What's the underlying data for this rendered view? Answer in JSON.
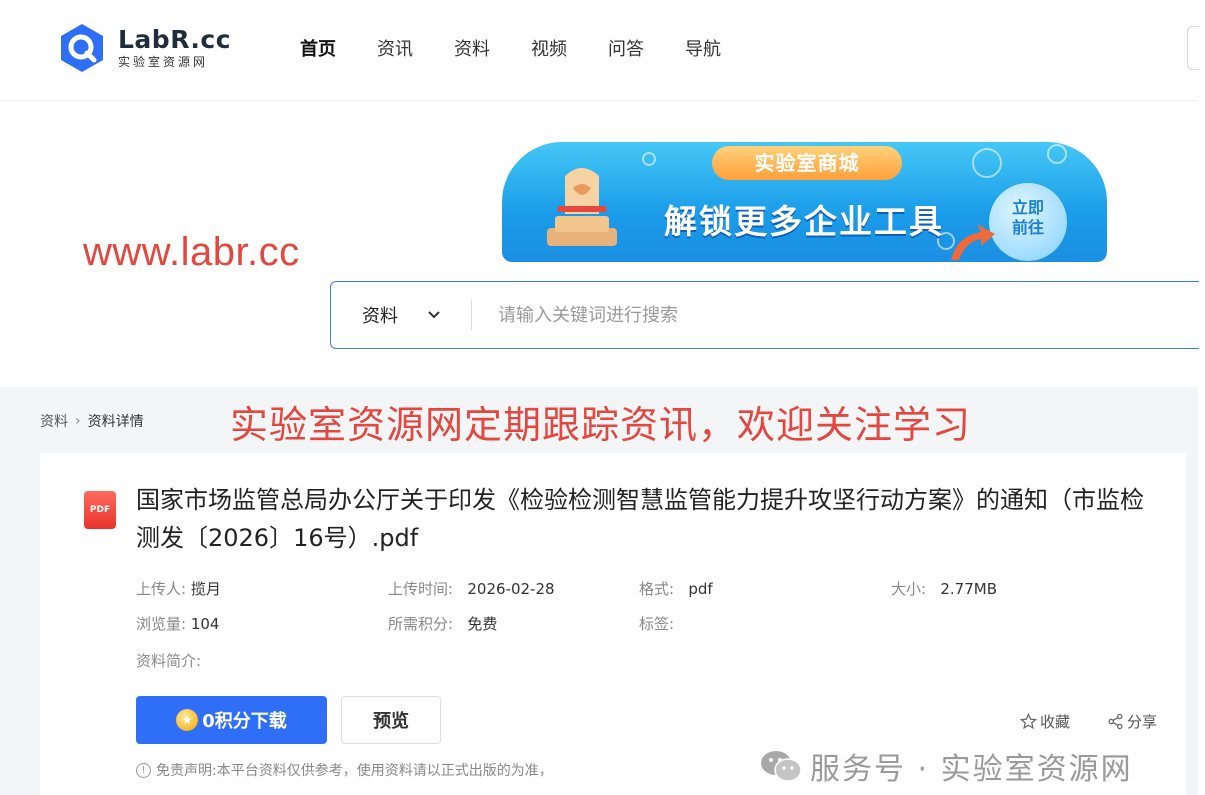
{
  "header": {
    "logo_main": "LabR.cc",
    "logo_sub": "实验室资源网",
    "nav": [
      "首页",
      "资讯",
      "资料",
      "视频",
      "问答",
      "导航"
    ]
  },
  "url_watermark": "www.labr.cc",
  "banner": {
    "tag": "实验室商城",
    "title": "解锁更多企业工具",
    "go_line1": "立即",
    "go_line2": "前往"
  },
  "search": {
    "category": "资料",
    "placeholder": "请输入关键词进行搜索"
  },
  "breadcrumb": {
    "root": "资料",
    "current": "资料详情"
  },
  "overlay_red_text": "实验室资源网定期跟踪资讯，欢迎关注学习",
  "document": {
    "icon_label": "PDF",
    "title": "国家市场监管总局办公厅关于印发《检验检测智慧监管能力提升攻坚行动方案》的通知（市监检测发〔2026〕16号）.pdf",
    "uploader_label": "上传人:",
    "uploader": "揽月",
    "upload_time_label": "上传时间:",
    "upload_time": "2026-02-28",
    "format_label": "格式:",
    "format": "pdf",
    "size_label": "大小:",
    "size": "2.77MB",
    "views_label": "浏览量:",
    "views": "104",
    "points_label": "所需积分:",
    "points": "免费",
    "tags_label": "标签:",
    "tags": "",
    "summary_label": "资料简介:"
  },
  "actions": {
    "download": "0积分下载",
    "preview": "预览",
    "favorite": "收藏",
    "share": "分享"
  },
  "disclaimer": "免责声明:本平台资料仅供参考，使用资料请以正式出版的为准，",
  "wechat_watermark": "服务号 · 实验室资源网",
  "colors": {
    "primary": "#2f6ef6",
    "watermark_red": "#e4473f"
  }
}
